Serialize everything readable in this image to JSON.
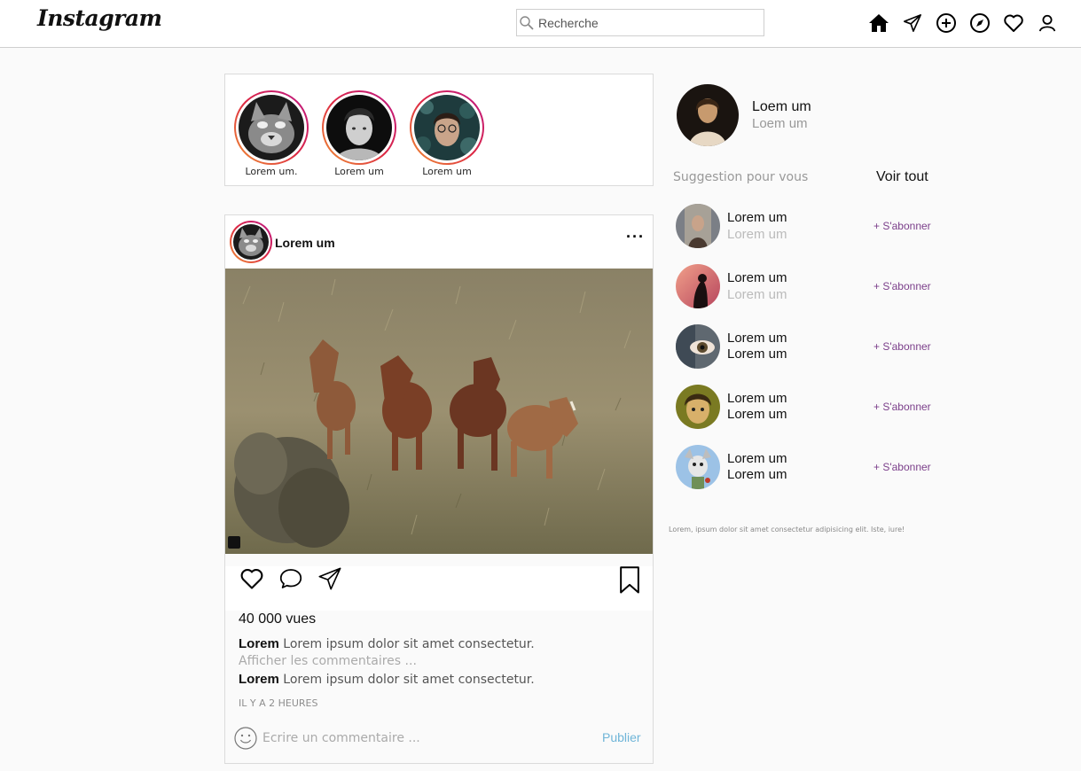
{
  "app": {
    "logo": "Instagram"
  },
  "search": {
    "placeholder": "Recherche"
  },
  "nav_icons": [
    "home-icon",
    "send-icon",
    "add-icon",
    "explore-icon",
    "heart-icon",
    "profile-icon"
  ],
  "stories": [
    {
      "name": "Lorem um."
    },
    {
      "name": "Lorem um"
    },
    {
      "name": "Lorem um"
    }
  ],
  "post": {
    "username": "Lorem um",
    "views": "40 000 vues",
    "captions": [
      {
        "user": "Lorem",
        "text": "Lorem ipsum dolor sit amet consectetur."
      },
      {
        "user": "Lorem",
        "text": "Lorem ipsum dolor sit amet consectetur."
      }
    ],
    "show_comments": "Afficher les commentaires ...",
    "time_ago": "IL Y A 2 HEURES",
    "comment_placeholder": "Ecrire un commentaire ...",
    "publish_label": "Publier"
  },
  "profile": {
    "name": "Loem um",
    "subtitle": "Loem um"
  },
  "suggestions": {
    "title": "Suggestion pour vous",
    "see_all": "Voir tout",
    "items": [
      {
        "name": "Lorem um",
        "subtitle": "Lorem um",
        "muted": true,
        "follow": "+ S'abonner"
      },
      {
        "name": "Lorem um",
        "subtitle": "Lorem um",
        "muted": true,
        "follow": "+ S'abonner"
      },
      {
        "name": "Lorem um",
        "subtitle": "Lorem um",
        "muted": false,
        "follow": "+ S'abonner"
      },
      {
        "name": "Lorem um",
        "subtitle": "Lorem um",
        "muted": false,
        "follow": "+ S'abonner"
      },
      {
        "name": "Lorem um",
        "subtitle": "Lorem um",
        "muted": false,
        "follow": "+ S'abonner"
      }
    ]
  },
  "footer": "Lorem, ipsum dolor sit amet consectetur adipisicing elit. Iste, iure!",
  "colors": {
    "accent_link": "#6fb5d8",
    "follow": "#7b3f8a",
    "story_ring": "#dc2743"
  }
}
